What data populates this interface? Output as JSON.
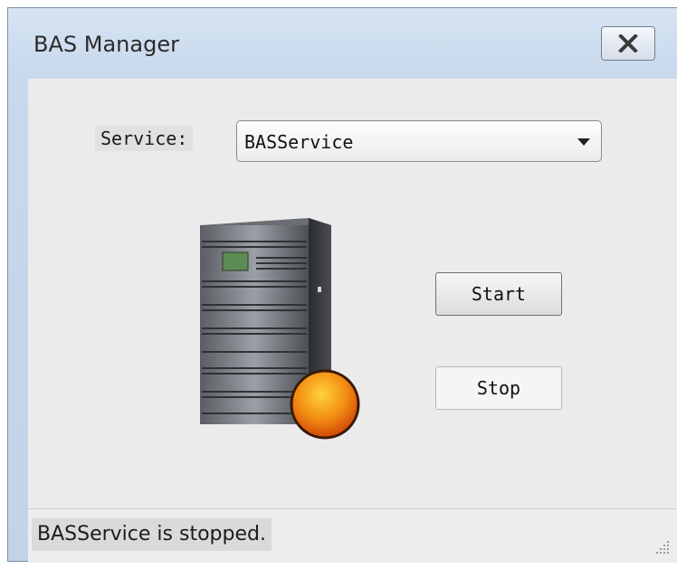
{
  "window": {
    "title": "BAS Manager",
    "close_icon": "close-x-icon"
  },
  "service": {
    "label": "Service:",
    "selected": "BASService",
    "dropdown_icon": "chevron-down-icon"
  },
  "graphic": {
    "server_icon": "server-tower-icon",
    "status_indicator_icon": "status-stopped-icon",
    "status_color": "#e8500a"
  },
  "buttons": {
    "start_label": "Start",
    "stop_label": "Stop"
  },
  "statusbar": {
    "message": "BASService is stopped.",
    "grip_icon": "resize-grip-icon"
  }
}
